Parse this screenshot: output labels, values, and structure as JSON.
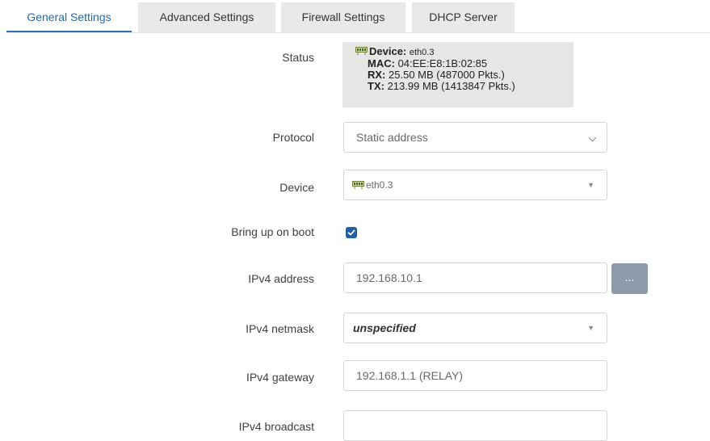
{
  "tabs": [
    {
      "label": "General Settings",
      "active": true
    },
    {
      "label": "Advanced Settings",
      "active": false
    },
    {
      "label": "Firewall Settings",
      "active": false
    },
    {
      "label": "DHCP Server",
      "active": false
    }
  ],
  "status": {
    "label": "Status",
    "device_key": "Device:",
    "device_val": "eth0.3",
    "mac_key": "MAC:",
    "mac_val": "04:EE:E8:1B:02:85",
    "rx_key": "RX:",
    "rx_val": "25.50 MB (487000 Pkts.)",
    "tx_key": "TX:",
    "tx_val": "213.99 MB (1413847 Pkts.)"
  },
  "protocol": {
    "label": "Protocol",
    "value": "Static address"
  },
  "device": {
    "label": "Device",
    "value": "eth0.3"
  },
  "boot": {
    "label": "Bring up on boot",
    "checked": true
  },
  "ipv4_address": {
    "label": "IPv4 address",
    "value": "192.168.10.1",
    "button": "..."
  },
  "ipv4_netmask": {
    "label": "IPv4 netmask",
    "value": "unspecified"
  },
  "ipv4_gateway": {
    "label": "IPv4 gateway",
    "value": "192.168.1.1 (RELAY)"
  },
  "ipv4_broadcast": {
    "label": "IPv4 broadcast",
    "value": ""
  },
  "colors": {
    "accent": "#1f5fa6",
    "tab_inactive": "#e9e9ea",
    "status_bg": "#e6e6e6",
    "button": "#8e9aab"
  },
  "icons": [
    "network-port-icon",
    "chevron-down-icon",
    "caret-down-icon",
    "checkmark-icon"
  ]
}
